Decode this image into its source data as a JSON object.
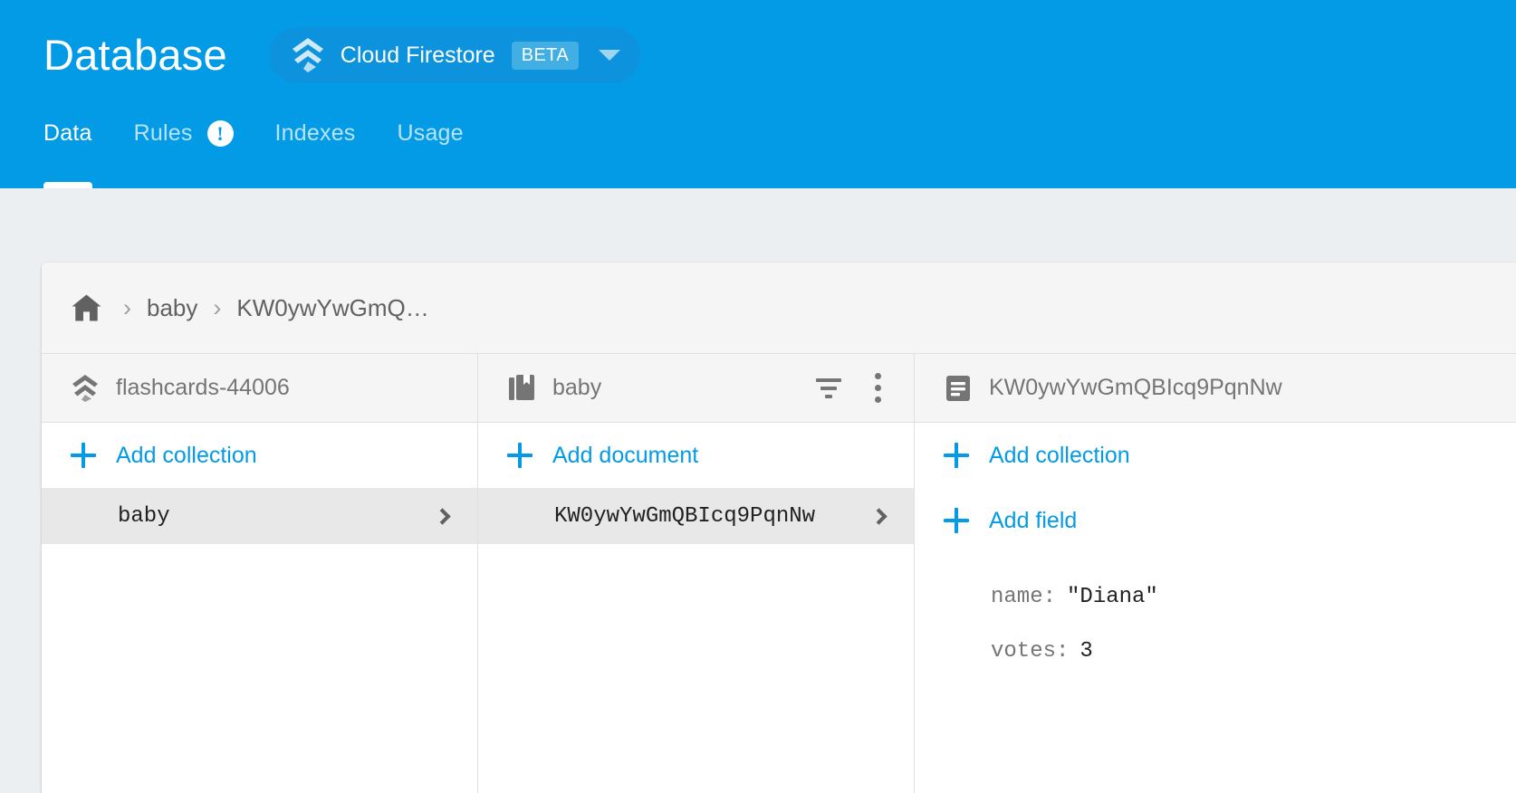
{
  "header": {
    "title": "Database",
    "product": {
      "name": "Cloud Firestore",
      "badge": "BETA",
      "logo_icon": "firebase-logo-icon",
      "caret_icon": "chevron-down-icon"
    },
    "tabs": [
      {
        "label": "Data",
        "active": true,
        "warning": false
      },
      {
        "label": "Rules",
        "active": false,
        "warning": true,
        "warning_icon": "error-exclamation-icon",
        "warning_glyph": "!"
      },
      {
        "label": "Indexes",
        "active": false,
        "warning": false
      },
      {
        "label": "Usage",
        "active": false,
        "warning": false
      }
    ],
    "colors": {
      "bar": "#039be5",
      "pill": "#0d93dd",
      "badge": "#41aee4",
      "accent": "#039be5"
    }
  },
  "breadcrumb": {
    "home_icon": "home-icon",
    "separator": "›",
    "items": [
      "baby",
      "KW0ywYwGmQ…"
    ]
  },
  "columns": [
    {
      "header_icon": "firebase-project-icon",
      "header_title": "flashcards-44006",
      "actions": [],
      "add": {
        "icon": "plus-icon",
        "label": "Add collection"
      },
      "rows": [
        {
          "text": "baby",
          "selected": true,
          "chevron": "chevron-right-icon"
        }
      ]
    },
    {
      "header_icon": "collection-bookmark-icon",
      "header_title": "baby",
      "actions": [
        {
          "icon": "filter-icon",
          "name": "filter-button"
        },
        {
          "icon": "more-vert-icon",
          "name": "overflow-menu-button"
        }
      ],
      "add": {
        "icon": "plus-icon",
        "label": "Add document"
      },
      "rows": [
        {
          "text": "KW0ywYwGmQBIcq9PqnNw",
          "selected": true,
          "chevron": "chevron-right-icon"
        }
      ]
    },
    {
      "header_icon": "document-icon",
      "header_title": "KW0ywYwGmQBIcq9PqnNw",
      "actions": [],
      "add": {
        "icon": "plus-icon",
        "label": "Add collection"
      },
      "add_field": {
        "icon": "plus-icon",
        "label": "Add field"
      },
      "fields": [
        {
          "key": "name",
          "colon": ":",
          "value": "\"Diana\""
        },
        {
          "key": "votes",
          "colon": ":",
          "value": "3"
        }
      ]
    }
  ]
}
